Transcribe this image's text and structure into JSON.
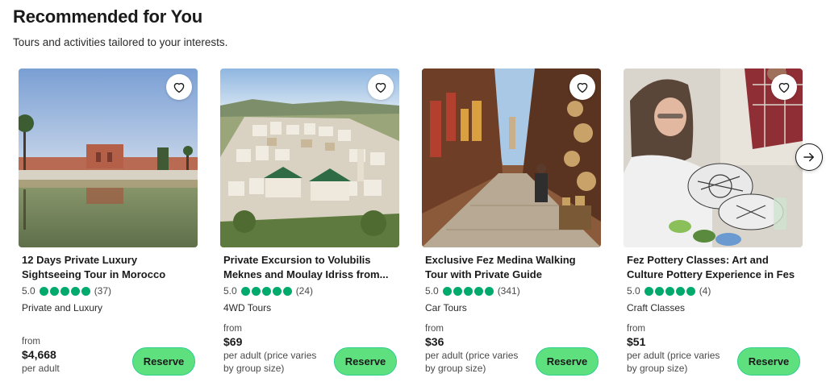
{
  "section": {
    "title": "Recommended for You",
    "subtitle": "Tours and activities tailored to your interests."
  },
  "colors": {
    "accent": "#5fe07f",
    "bubble": "#00aa6c"
  },
  "cards": [
    {
      "name": "12 Days Private Luxury Sightseeing Tour in Morocco",
      "rating": "5.0",
      "reviews": "(37)",
      "bubbles_filled": 5,
      "category": "Private and Luxury",
      "price_from": "from",
      "price": "$4,668",
      "price_unit": "per adult",
      "reserve_label": "Reserve",
      "heart_icon": "heart-outline-icon"
    },
    {
      "name": "Private Excursion to Volubilis Meknes and Moulay Idriss from...",
      "rating": "5.0",
      "reviews": "(24)",
      "bubbles_filled": 5,
      "category": "4WD Tours",
      "price_from": "from",
      "price": "$69",
      "price_unit": "per adult (price varies by group size)",
      "reserve_label": "Reserve",
      "heart_icon": "heart-outline-icon"
    },
    {
      "name": "Exclusive Fez Medina Walking Tour with Private Guide",
      "rating": "5.0",
      "reviews": "(341)",
      "bubbles_filled": 5,
      "category": "Car Tours",
      "price_from": "from",
      "price": "$36",
      "price_unit": "per adult (price varies by group size)",
      "reserve_label": "Reserve",
      "heart_icon": "heart-outline-icon"
    },
    {
      "name": "Fez Pottery Classes: Art and Culture Pottery Experience in Fes",
      "rating": "5.0",
      "reviews": "(4)",
      "bubbles_filled": 5,
      "category": "Craft Classes",
      "price_from": "from",
      "price": "$51",
      "price_unit": "per adult (price varies by group size)",
      "reserve_label": "Reserve",
      "heart_icon": "heart-outline-icon"
    }
  ],
  "carousel": {
    "next_icon": "arrow-right-icon"
  }
}
